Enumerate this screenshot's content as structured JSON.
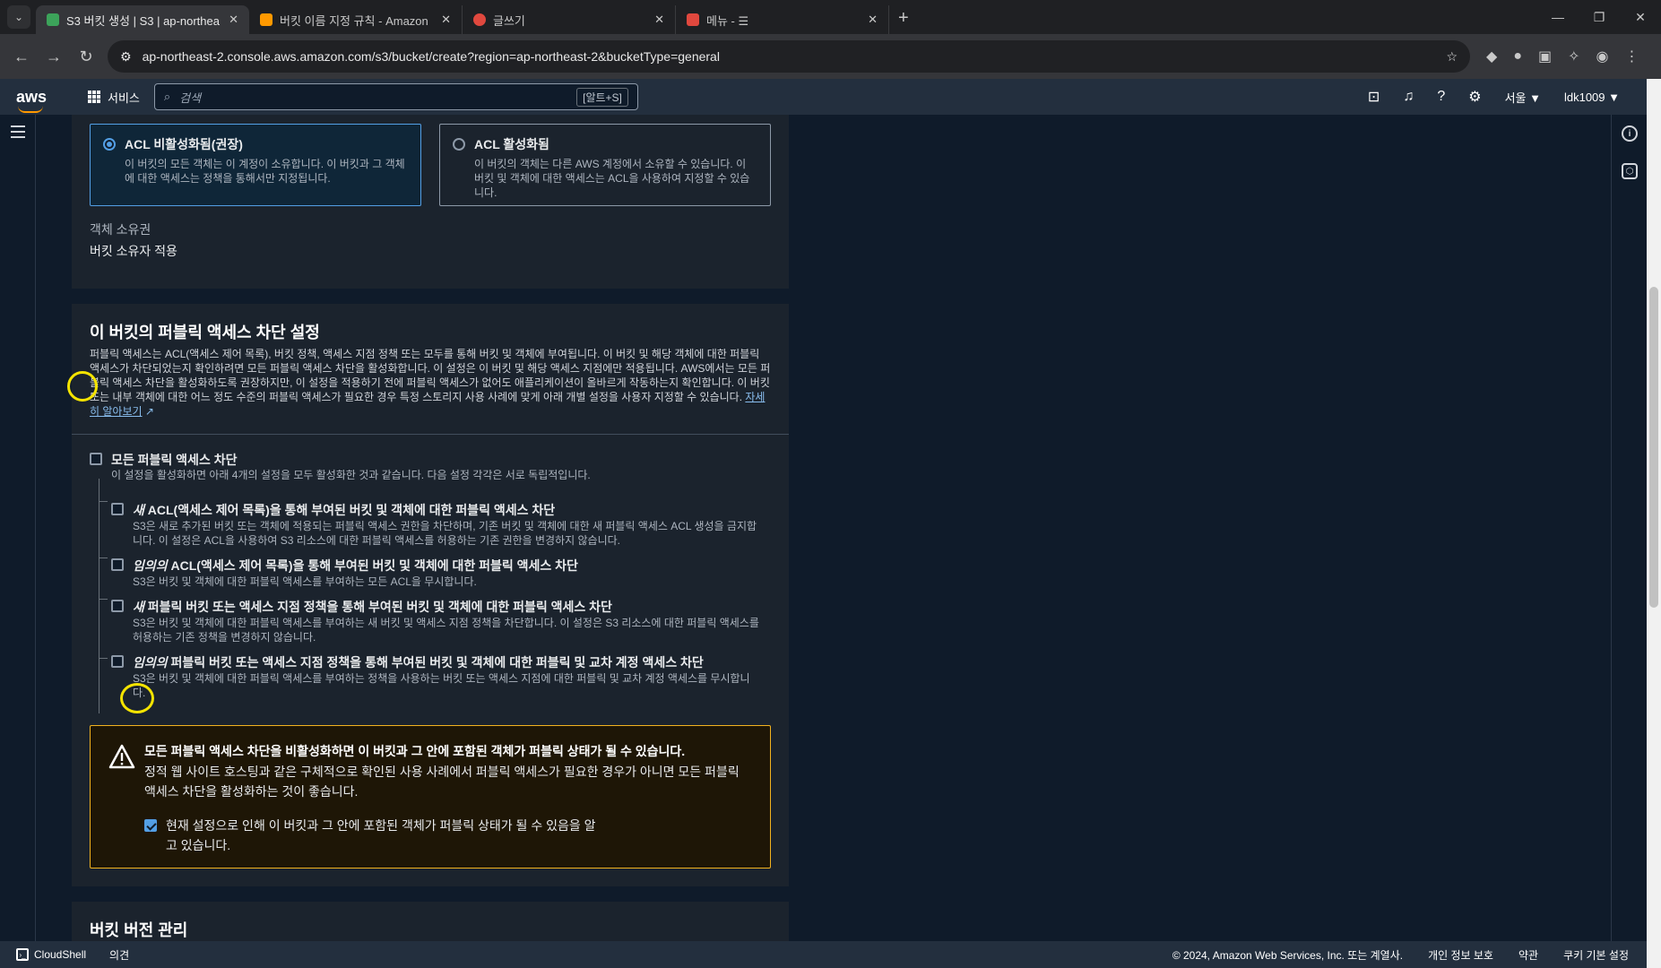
{
  "browser": {
    "tabs": [
      {
        "title": "S3 버킷 생성 | S3 | ap-northea",
        "active": true,
        "favicon_color": "#3ca35a"
      },
      {
        "title": "버킷 이름 지정 규칙 - Amazon",
        "active": false,
        "favicon_color": "#ff9900"
      },
      {
        "title": "글쓰기",
        "active": false,
        "favicon_color": "#e0483e"
      },
      {
        "title": "메뉴 - ☰",
        "active": false,
        "favicon_color": "#e0483e"
      }
    ],
    "url": "ap-northeast-2.console.aws.amazon.com/s3/bucket/create?region=ap-northeast-2&bucketType=general"
  },
  "awsnav": {
    "logo": "aws",
    "services_label": "서비스",
    "search_placeholder": "검색",
    "search_shortcut": "[알트+S]",
    "region": "서울 ▼",
    "account": "ldk1009 ▼"
  },
  "object_ownership": {
    "option_disabled": {
      "label": "ACL 비활성화됨(권장)",
      "desc": "이 버킷의 모든 객체는 이 계정이 소유합니다. 이 버킷과 그 객체에 대한 액세스는 정책을 통해서만 지정됩니다."
    },
    "option_enabled": {
      "label": "ACL 활성화됨",
      "desc": "이 버킷의 객체는 다른 AWS 계정에서 소유할 수 있습니다. 이 버킷 및 객체에 대한 액세스는 ACL을 사용하여 지정할 수 있습니다."
    },
    "ownership_label": "객체 소유권",
    "ownership_value": "버킷 소유자 적용"
  },
  "public_access": {
    "heading": "이 버킷의 퍼블릭 액세스 차단 설정",
    "description": "퍼블릭 액세스는 ACL(액세스 제어 목록), 버킷 정책, 액세스 지점 정책 또는 모두를 통해 버킷 및 객체에 부여됩니다. 이 버킷 및 해당 객체에 대한 퍼블릭 액세스가 차단되었는지 확인하려면 모든 퍼블릭 액세스 차단을 활성화합니다. 이 설정은 이 버킷 및 해당 액세스 지점에만 적용됩니다. AWS에서는 모든 퍼블릭 액세스 차단을 활성화하도록 권장하지만, 이 설정을 적용하기 전에 퍼블릭 액세스가 없어도 애플리케이션이 올바르게 작동하는지 확인합니다. 이 버킷 또는 내부 객체에 대한 어느 정도 수준의 퍼블릭 액세스가 필요한 경우 특정 스토리지 사용 사례에 맞게 아래 개별 설정을 사용자 지정할 수 있습니다.",
    "learn_more": "자세히 알아보기",
    "block_all": {
      "label": "모든 퍼블릭 액세스 차단",
      "desc": "이 설정을 활성화하면 아래 4개의 설정을 모두 활성화한 것과 같습니다. 다음 설정 각각은 서로 독립적입니다.",
      "checked": false
    },
    "options": [
      {
        "prefix": "새",
        "label": " ACL(액세스 제어 목록)을 통해 부여된 버킷 및 객체에 대한 퍼블릭 액세스 차단",
        "desc": "S3은 새로 추가된 버킷 또는 객체에 적용되는 퍼블릭 액세스 권한을 차단하며, 기존 버킷 및 객체에 대한 새 퍼블릭 액세스 ACL 생성을 금지합니다. 이 설정은 ACL을 사용하여 S3 리소스에 대한 퍼블릭 액세스를 허용하는 기존 권한을 변경하지 않습니다.",
        "checked": false
      },
      {
        "prefix": "임의의",
        "label": " ACL(액세스 제어 목록)을 통해 부여된 버킷 및 객체에 대한 퍼블릭 액세스 차단",
        "desc": "S3은 버킷 및 객체에 대한 퍼블릭 액세스를 부여하는 모든 ACL을 무시합니다.",
        "checked": false
      },
      {
        "prefix": "새",
        "label": " 퍼블릭 버킷 또는 액세스 지점 정책을 통해 부여된 버킷 및 객체에 대한 퍼블릭 액세스 차단",
        "desc": "S3은 버킷 및 객체에 대한 퍼블릭 액세스를 부여하는 새 버킷 및 액세스 지점 정책을 차단합니다. 이 설정은 S3 리소스에 대한 퍼블릭 액세스를 허용하는 기존 정책을 변경하지 않습니다.",
        "checked": false
      },
      {
        "prefix": "임의의",
        "label": " 퍼블릭 버킷 또는 액세스 지점 정책을 통해 부여된 버킷 및 객체에 대한 퍼블릭 및 교차 계정 액세스 차단",
        "desc": "S3은 버킷 및 객체에 대한 퍼블릭 액세스를 부여하는 정책을 사용하는 버킷 또는 액세스 지점에 대한 퍼블릭 및 교차 계정 액세스를 무시합니다.",
        "checked": false
      }
    ],
    "warning": {
      "title": "모든 퍼블릭 액세스 차단을 비활성화하면 이 버킷과 그 안에 포함된 객체가 퍼블릭 상태가 될 수 있습니다.",
      "body": "정적 웹 사이트 호스팅과 같은 구체적으로 확인된 사용 사례에서 퍼블릭 액세스가 필요한 경우가 아니면 모든 퍼블릭 액세스 차단을 활성화하는 것이 좋습니다.",
      "ack_label": "현재 설정으로 인해 이 버킷과 그 안에 포함된 객체가 퍼블릭 상태가 될 수 있음을 알고 있습니다.",
      "ack_checked": true
    }
  },
  "versioning": {
    "heading": "버킷 버전 관리"
  },
  "footer": {
    "cloudshell": "CloudShell",
    "feedback": "의견",
    "copyright": "© 2024, Amazon Web Services, Inc. 또는 계열사.",
    "privacy": "개인 정보 보호",
    "terms": "약관",
    "cookies": "쿠키 기본 설정"
  },
  "colors": {
    "accent": "#539fe5",
    "warning_border": "#f2b21f",
    "annotation": "#f5e400"
  }
}
